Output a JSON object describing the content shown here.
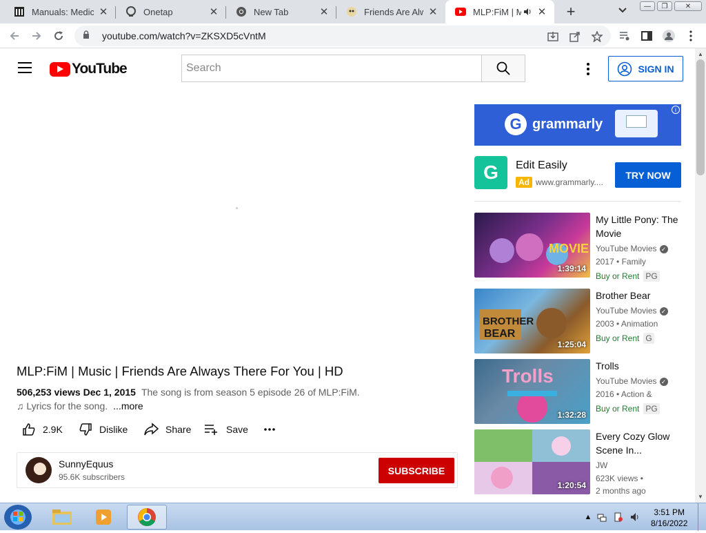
{
  "browser": {
    "tabs": [
      {
        "title": "Manuals: Medical",
        "icon": "library-icon"
      },
      {
        "title": "Onetap",
        "icon": "onetap-icon"
      },
      {
        "title": "New Tab",
        "icon": "chrome-icon"
      },
      {
        "title": "Friends Are Alway",
        "icon": "pony-icon"
      },
      {
        "title": "MLP:FiM | Mu",
        "icon": "youtube-icon",
        "active": true
      }
    ],
    "url": "youtube.com/watch?v=ZKSXD5cVntM"
  },
  "header": {
    "logo": "YouTube",
    "search_placeholder": "Search",
    "signin_label": "SIGN IN"
  },
  "video": {
    "title": "MLP:FiM | Music | Friends Are Always There For You | HD",
    "views": "506,253 views",
    "date": "Dec 1, 2015",
    "description_line1": "The song is from season 5 episode 26 of MLP:FiM.",
    "description_line2": "♫ Lyrics for the song.",
    "more": "...more",
    "likes": "2.9K",
    "dislike": "Dislike",
    "share": "Share",
    "save": "Save"
  },
  "channel": {
    "name": "SunnyEquus",
    "subscribers": "95.6K subscribers",
    "subscribe": "SUBSCRIBE"
  },
  "ad": {
    "banner_text": "grammarly",
    "title": "Edit Easily",
    "badge": "Ad",
    "domain": "www.grammarly....",
    "cta": "TRY NOW",
    "colors": {
      "banner": "#2f5fd6",
      "logo": "#15c39a"
    }
  },
  "recommendations": [
    {
      "title": "My Little Pony: The Movie",
      "channel": "YouTube Movies",
      "meta": "2017 • Family",
      "buy": "Buy or Rent",
      "rating": "PG",
      "duration": "1:39:14",
      "thumb_colors": [
        "#2a1b4a",
        "#c93a9a"
      ]
    },
    {
      "title": "Brother Bear",
      "channel": "YouTube Movies",
      "meta": "2003 • Animation",
      "buy": "Buy or Rent",
      "rating": "G",
      "duration": "1:25:04",
      "thumb_colors": [
        "#3a86c9",
        "#e0a23a"
      ]
    },
    {
      "title": "Trolls",
      "channel": "YouTube Movies",
      "meta": "2016 • Action &",
      "buy": "Buy or Rent",
      "rating": "PG",
      "duration": "1:32:28",
      "thumb_colors": [
        "#3c6a8c",
        "#e24a9c"
      ]
    },
    {
      "title": "Every Cozy Glow Scene In...",
      "channel": "JW",
      "meta": "623K views •",
      "meta2": "2 months ago",
      "duration": "1:20:54",
      "thumb_colors": [
        "#7fbf6a",
        "#8a5aa6"
      ]
    }
  ],
  "taskbar": {
    "time": "3:51 PM",
    "date": "8/16/2022"
  }
}
